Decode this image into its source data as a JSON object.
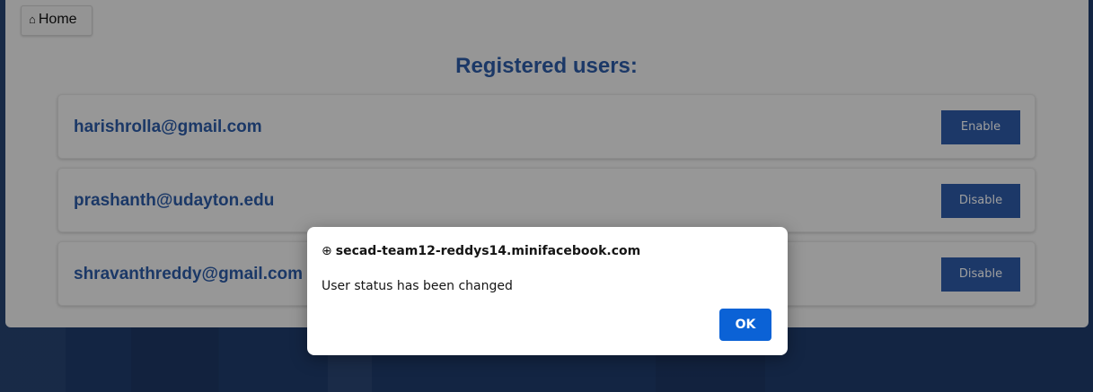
{
  "nav": {
    "home_icon": "⌂",
    "home_label": "Home"
  },
  "page": {
    "title": "Registered users:"
  },
  "users": [
    {
      "email": "harishrolla@gmail.com",
      "action": "Enable"
    },
    {
      "email": "prashanth@udayton.edu",
      "action": "Disable"
    },
    {
      "email": "shravanthreddy@gmail.com",
      "action": "Disable"
    }
  ],
  "dialog": {
    "origin_icon": "globe-icon",
    "origin": "secad-team12-reddys14.minifacebook.com",
    "message": "User status has been changed",
    "ok_label": "OK"
  },
  "colors": {
    "accent": "#2c5ba6",
    "button": "#2e5ba8",
    "ok_button": "#0b62d6",
    "page_bg": "#1f3c6d"
  }
}
